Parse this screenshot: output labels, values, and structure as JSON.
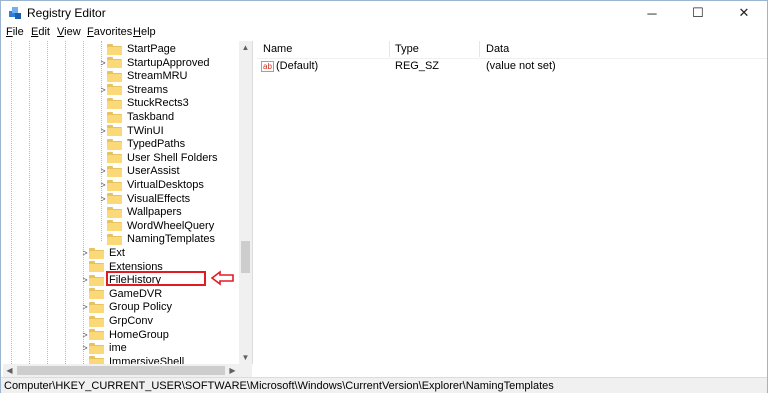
{
  "window": {
    "title": "Registry Editor",
    "controls": {
      "minimize": "─",
      "maximize": "☐",
      "close": "✕"
    }
  },
  "menu": [
    {
      "key": "F",
      "rest": "ile"
    },
    {
      "key": "E",
      "rest": "dit"
    },
    {
      "key": "V",
      "rest": "iew"
    },
    {
      "key": "F",
      "rest": "avorites",
      "prefix": "F",
      "label": "Favorites"
    },
    {
      "key": "H",
      "rest": "elp"
    }
  ],
  "tree": {
    "items": [
      {
        "label": "StartPage",
        "expander": ""
      },
      {
        "label": "StartupApproved",
        "expander": ">"
      },
      {
        "label": "StreamMRU",
        "expander": ""
      },
      {
        "label": "Streams",
        "expander": ">"
      },
      {
        "label": "StuckRects3",
        "expander": ""
      },
      {
        "label": "Taskband",
        "expander": ""
      },
      {
        "label": "TWinUI",
        "expander": ">"
      },
      {
        "label": "TypedPaths",
        "expander": ""
      },
      {
        "label": "User Shell Folders",
        "expander": ""
      },
      {
        "label": "UserAssist",
        "expander": ">"
      },
      {
        "label": "VirtualDesktops",
        "expander": ">"
      },
      {
        "label": "VisualEffects",
        "expander": ">"
      },
      {
        "label": "Wallpapers",
        "expander": ""
      },
      {
        "label": "WordWheelQuery",
        "expander": ""
      },
      {
        "label": "NamingTemplates",
        "expander": ""
      },
      {
        "label": "Ext",
        "expander": ">"
      },
      {
        "label": "Extensions",
        "expander": ""
      },
      {
        "label": "FileHistory",
        "expander": ">"
      },
      {
        "label": "GameDVR",
        "expander": ""
      },
      {
        "label": "Group Policy",
        "expander": ">"
      },
      {
        "label": "GrpConv",
        "expander": ""
      },
      {
        "label": "HomeGroup",
        "expander": ">"
      },
      {
        "label": "ime",
        "expander": ">"
      },
      {
        "label": "ImmersiveShell",
        "expander": ""
      }
    ],
    "selected": "NamingTemplates"
  },
  "columns": [
    "Name",
    "Type",
    "Data"
  ],
  "values": [
    {
      "icon": "ab",
      "name": "(Default)",
      "type": "REG_SZ",
      "data": "(value not set)"
    }
  ],
  "status": "Computer\\HKEY_CURRENT_USER\\SOFTWARE\\Microsoft\\Windows\\CurrentVersion\\Explorer\\NamingTemplates",
  "colors": {
    "highlight": "#e01b24",
    "folder": "#fbd978"
  }
}
